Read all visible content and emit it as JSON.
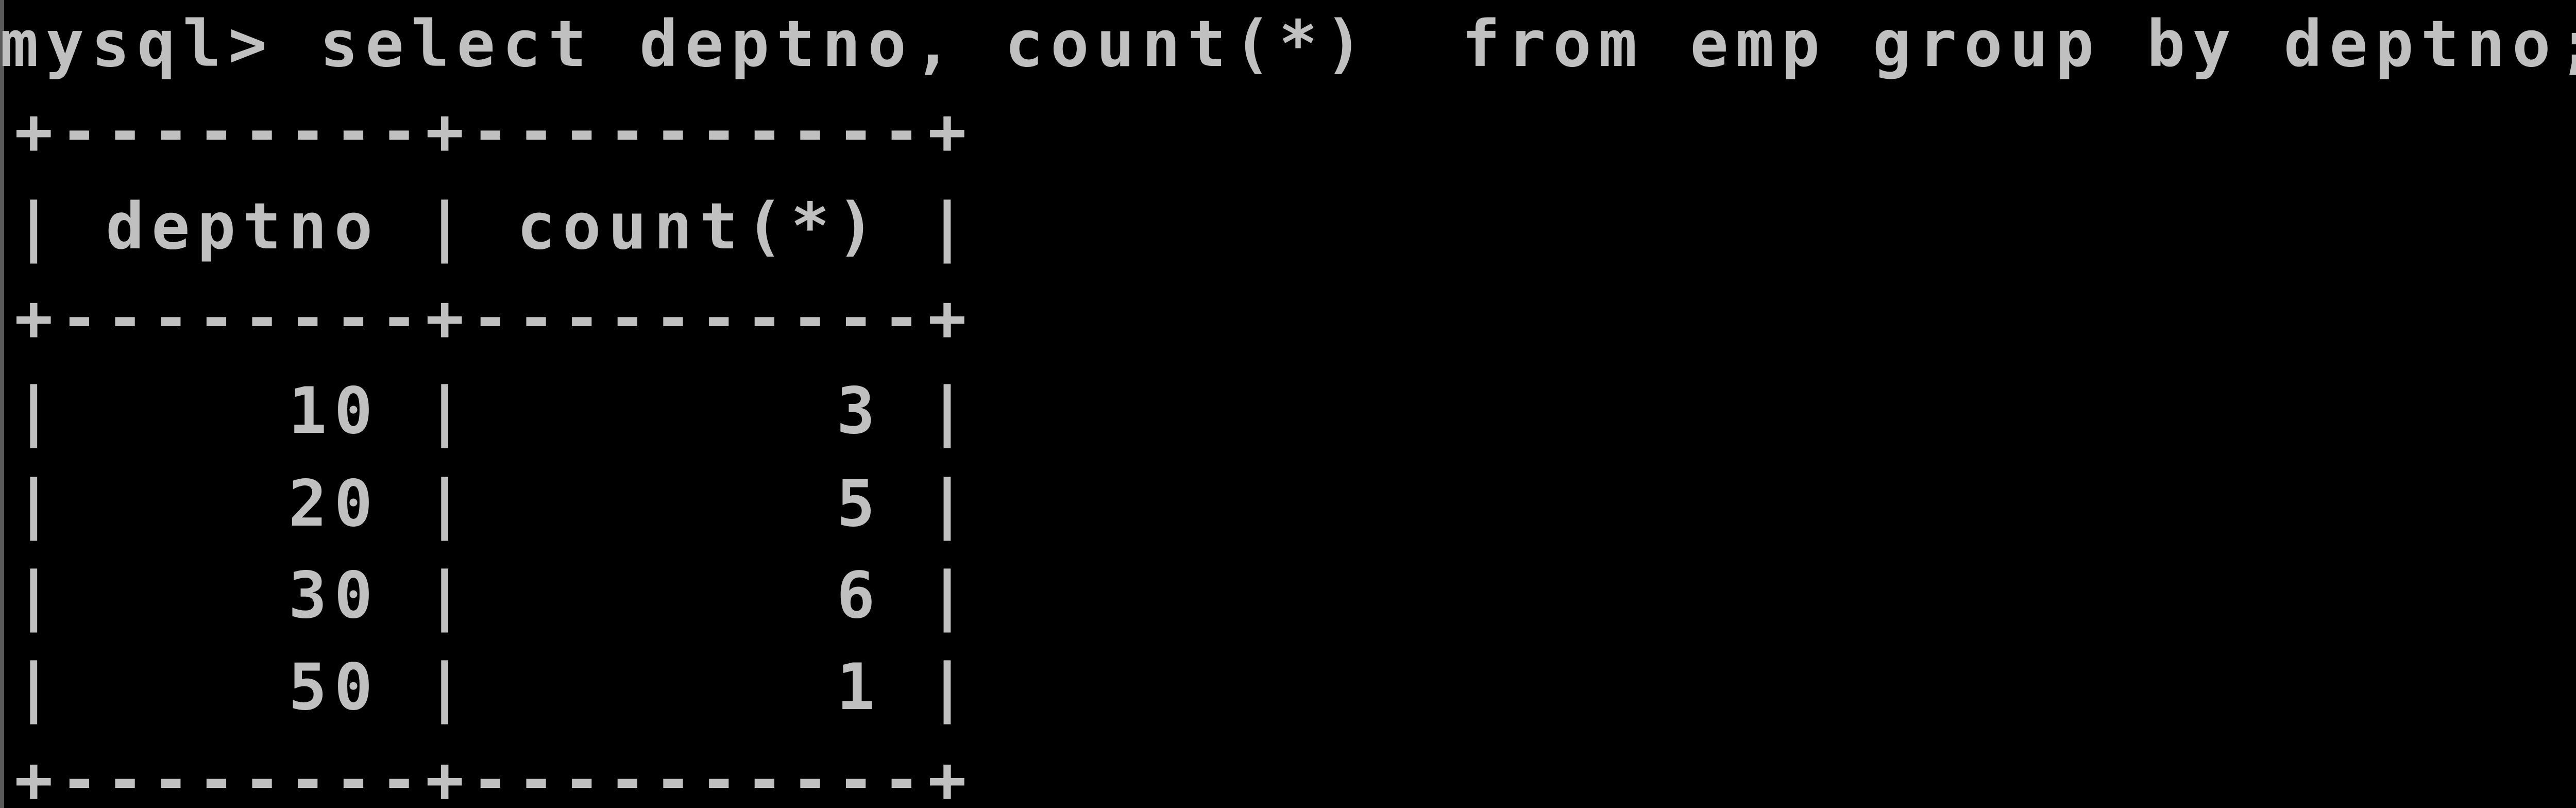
{
  "console": {
    "prompt": "mysql> select deptno, count(*)  from emp group by deptno;",
    "border": "+--------+----------+",
    "header": "| deptno | count(*) |",
    "rows": [
      "|     10 |        3 |",
      "|     20 |        5 |",
      "|     30 |        6 |",
      "|     50 |        1 |"
    ]
  },
  "table": {
    "columns": [
      "deptno",
      "count(*)"
    ],
    "values": [
      [
        "10",
        "3"
      ],
      [
        "20",
        "5"
      ],
      [
        "30",
        "6"
      ],
      [
        "50",
        "1"
      ]
    ]
  },
  "colors": {
    "background": "#000000",
    "text": "#c0c0c0"
  }
}
